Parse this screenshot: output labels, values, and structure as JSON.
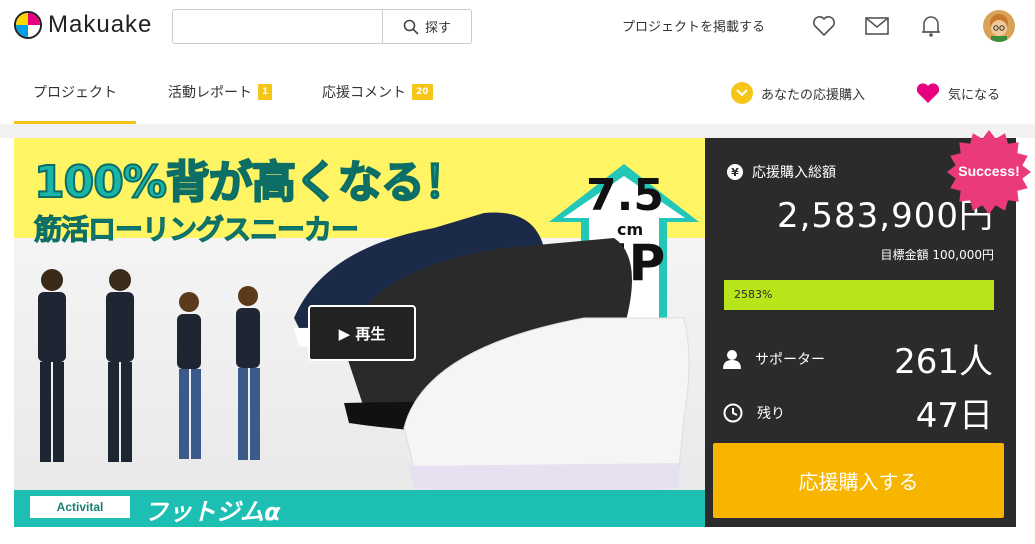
{
  "header": {
    "brand": "Makuake",
    "search": {
      "placeholder": "",
      "button_label": "探す"
    },
    "post_project_label": "プロジェクトを掲載する"
  },
  "tabs": [
    {
      "label": "プロジェクト"
    },
    {
      "label": "活動レポート",
      "badge": "1"
    },
    {
      "label": "応援コメント",
      "badge": "20"
    }
  ],
  "actions": {
    "supported_label": "あなたの応援購入",
    "favorite_label": "気になる"
  },
  "hero": {
    "title": "100%背が高くなる！",
    "subtitle": "筋活ローリングスニーカー",
    "arrow_value": "7.5",
    "arrow_unit": "cm",
    "arrow_up": "UP",
    "brand_logo": "Activital",
    "product_name": "フットジムα",
    "play_label": "▶ 再生"
  },
  "panel": {
    "success_label": "Success!",
    "total_label": "応援購入総額",
    "total_amount": "2,583,900円",
    "goal": "目標金額 100,000円",
    "progress_percent": 2583,
    "progress_text": "2583%",
    "supporters_label": "サポーター",
    "supporters_value": "261人",
    "remaining_label": "残り",
    "remaining_value": "47日",
    "cta_label": "応援購入する"
  },
  "colors": {
    "accent": "#f5c518",
    "favorite": "#e6007e",
    "progress": "#b8e51a",
    "cta": "#f7b500",
    "panel": "#2b2b2b"
  }
}
